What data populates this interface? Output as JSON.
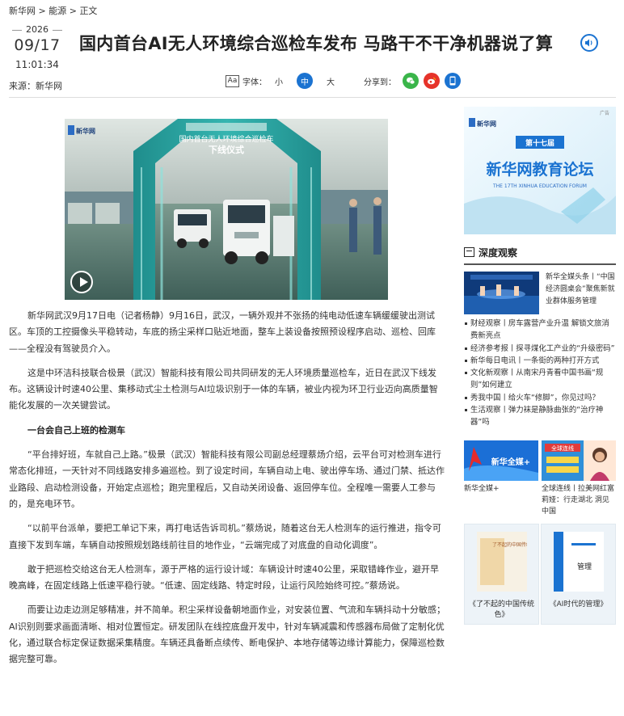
{
  "breadcrumb": [
    "新华网",
    ">",
    "能源",
    ">",
    "正文"
  ],
  "date": {
    "year": "2026",
    "month_day": "09/17",
    "time": "11:01:34"
  },
  "source": "来源：新华网",
  "title": "国内首台AI无人环境综合巡检车发布 马路干不干净机器说了算",
  "toolbar": {
    "aa_icon": "Aa",
    "font_label": "字体：",
    "sizes": [
      "小",
      "中",
      "大"
    ],
    "active_size": "中",
    "share_label": "分享到："
  },
  "share": [
    "wechat-icon",
    "weibo-icon",
    "mobile-icon"
  ],
  "video": {
    "logo": "新华网",
    "banner_line1": "国内首台无人环境综合巡检车",
    "banner_line2": "下线仪式"
  },
  "article": {
    "paragraphs": [
      "新华网武汉9月17日电（记者杨静）9月16日，武汉，一辆外观并不张扬的纯电动低速车辆缓缓驶出测试区。车顶的工控摄像头平稳转动，车底的扬尘采样口贴近地面，整车上装设备按照预设程序启动、巡检、回库——全程没有驾驶员介入。",
      "这是中环洁科技联合极景（武汉）智能科技有限公司共同研发的无人环境质量巡检车，近日在武汉下线发布。这辆设计时速40公里、集移动式尘土检测与AI垃圾识别于一体的车辆，被业内视为环卫行业迈向高质量智能化发展的一次关键尝试。",
      "一台会自己上班的检测车",
      "“平台排好班，车就自己上路。”极景（武汉）智能科技有限公司副总经理蔡炀介绍，云平台可对检测车进行常态化排班，一天针对不同线路安排多遍巡检。到了设定时间，车辆自动上电、驶出停车场、通过门禁、抵达作业路段、启动检测设备，开始定点巡检；跑完里程后，又自动关闭设备、返回停车位。全程唯一需要人工参与的，是充电环节。",
      "“以前平台派单，要把工单记下来，再打电话告诉司机。”蔡炀说，随着这台无人检测车的运行推进，指令可直接下发到车端，车辆自动按照规划路线前往目的地作业，“云端完成了对底盘的自动化调度”。",
      "敢于把巡检交给这台无人检测车，源于严格的运行设计域：车辆设计时速40公里，采取错峰作业，避开早晚高峰，在固定线路上低速平稳行驶。“低速、固定线路、特定时段，让运行风险始终可控。”蔡炀说。",
      "而要让边走边测足够精准，并不简单。积尘采样设备朝地面作业，对安装位置、气流和车辆抖动十分敏感；AI识别则要求画面清晰、相对位置恒定。研发团队在线控底盘开发中，针对车辆减震和传感器布局做了定制化优化，通过联合标定保证数据采集精度。车辆还具备断点续传、断电保护、本地存储等边缘计算能力，保障巡检数据完整可靠。"
    ]
  },
  "sidebar": {
    "ad": {
      "badge": "广告",
      "logo": "新华网",
      "edition": "第十七届",
      "title": "新华网教育论坛",
      "subtitle": "THE 17TH XINHUA EDUCATION FORUM"
    },
    "section_title": "深度观察",
    "featured_caption": "新华全媒头条丨“中国经济圆桌会”聚焦新就业群体服务管理",
    "news": [
      "财经观察丨房车露营产业升温 解锁文旅消费新亮点",
      "经济参考报丨探寻煤化工产业的“升级密码”",
      "新华每日电讯丨一条街的两种打开方式",
      "文化新观察丨从南宋丹青看中国书画“规则”如何建立",
      "秀我中国丨给火车“修脚”，你见过吗？",
      "生活观察丨弹力袜是静脉曲张的“治疗神器”吗"
    ],
    "cards": [
      {
        "logo_text": "新华全媒+",
        "caption": "新华全媒+"
      },
      {
        "logo_text": "全球连线",
        "caption": "全球连线丨拉美网红富莉娅：行走湖北 洞见中国"
      }
    ],
    "books": [
      {
        "cover_title": "了不起的中国传统色",
        "caption": "《了不起的中国传统色》"
      },
      {
        "cover_title": "管理",
        "caption": "《AI时代的管理》"
      }
    ]
  }
}
